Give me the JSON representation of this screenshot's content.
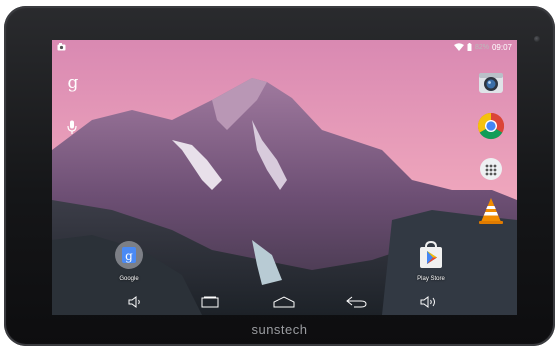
{
  "device": {
    "brand": "sunstech"
  },
  "statusbar": {
    "battery_pct": "82%",
    "time": "09:07"
  },
  "search": {
    "google_letter": "g"
  },
  "desktop_icons": [
    {
      "label": "Google",
      "icon": "google-folder-icon"
    },
    {
      "label": "Play Store",
      "icon": "play-store-icon"
    }
  ],
  "right_dock": [
    {
      "icon": "camera-icon"
    },
    {
      "icon": "chrome-icon"
    },
    {
      "icon": "app-drawer-icon"
    },
    {
      "icon": "vlc-icon"
    }
  ],
  "navbar": [
    {
      "icon": "volume-down-icon"
    },
    {
      "icon": "recent-apps-icon"
    },
    {
      "icon": "home-icon"
    },
    {
      "icon": "back-icon"
    },
    {
      "icon": "volume-up-icon"
    }
  ],
  "colors": {
    "sky_top": "#e69ab5",
    "sky_bottom": "#f3b9c3",
    "mountain": "#7d5a7e",
    "chrome_red": "#db4437",
    "chrome_yellow": "#f4c20d",
    "chrome_green": "#0f9d58",
    "chrome_blue": "#4285f4",
    "vlc_orange": "#f28c00"
  }
}
